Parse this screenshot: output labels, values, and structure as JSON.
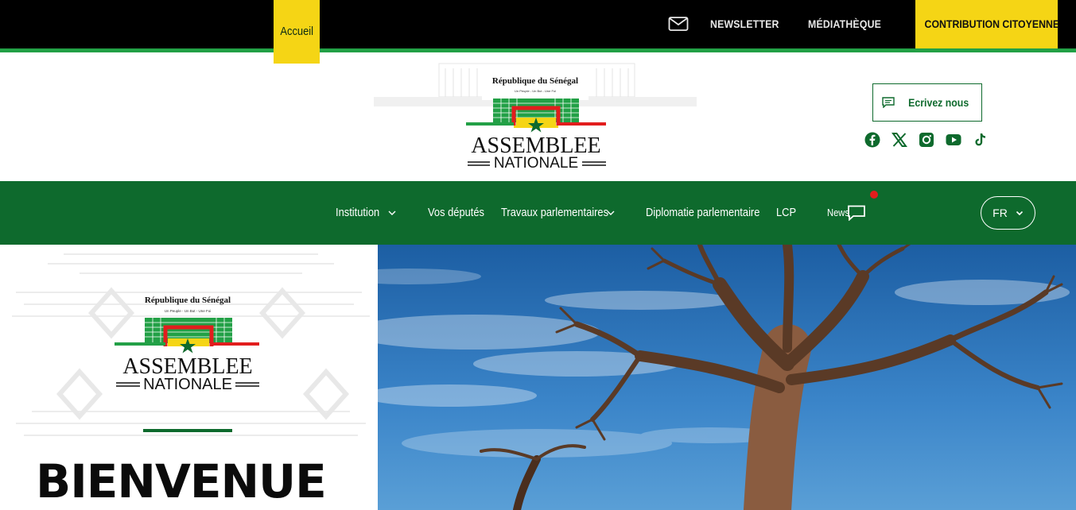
{
  "topbar": {
    "newsletter": "NEWSLETTER",
    "mediatheque": "MÉDIATHÈQUE",
    "contribution": "CONTRIBUTION CITOYENNE"
  },
  "logo": {
    "republic": "République du Sénégal",
    "motto": "Un Peuple - Un But - Une Foi",
    "line1": "ASSEMBLEE",
    "line2": "NATIONALE"
  },
  "header": {
    "write_us": "Ecrivez nous",
    "socials": [
      "facebook-icon",
      "x-icon",
      "instagram-icon",
      "youtube-icon",
      "tiktok-icon"
    ]
  },
  "nav": {
    "items": [
      {
        "label": "Accueil",
        "active": true
      },
      {
        "label": "Institution",
        "dropdown": true
      },
      {
        "label": "Vos députés"
      },
      {
        "label": "Travaux parlementaires",
        "dropdown": true
      },
      {
        "label": "Diplomatie parlementaire"
      },
      {
        "label": "LCP"
      },
      {
        "label": "News"
      }
    ],
    "language": "FR"
  },
  "hero": {
    "heading": "BIENVENUE"
  },
  "colors": {
    "green": "#0e6a2d",
    "yellow": "#f5d515",
    "red": "#e21d1d",
    "black": "#000000"
  }
}
